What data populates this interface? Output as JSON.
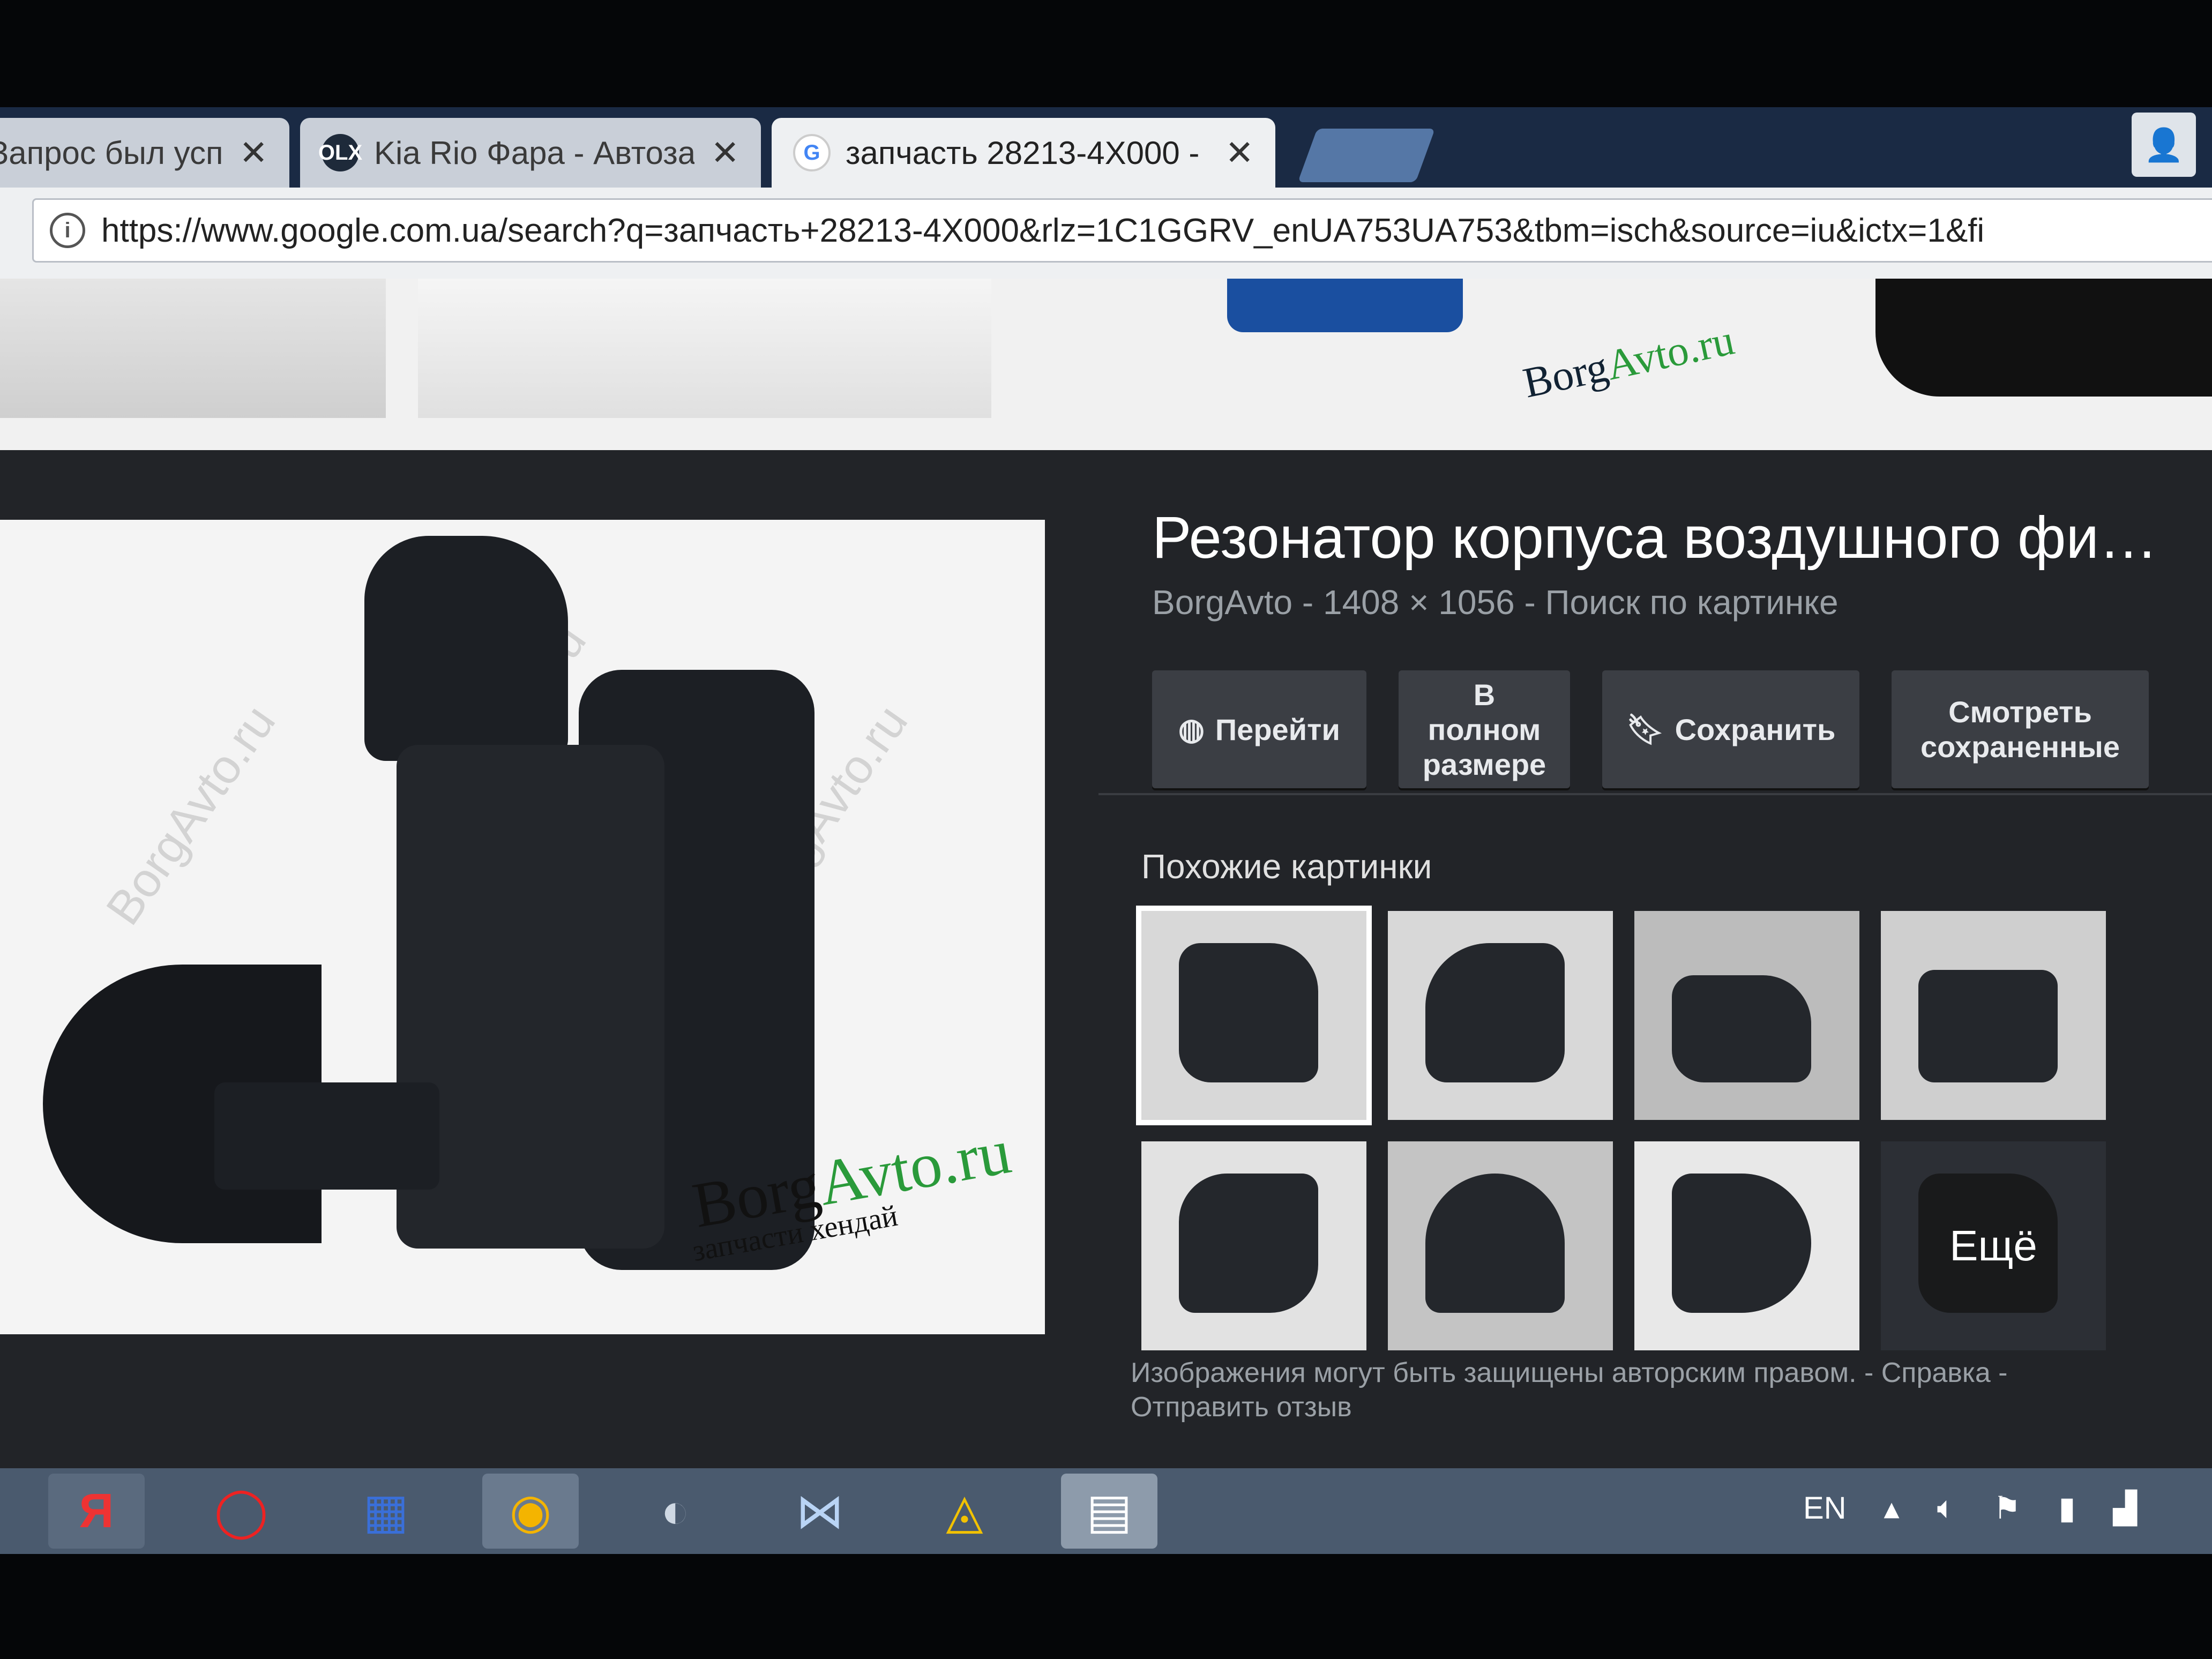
{
  "tabs": [
    {
      "label": "Запрос был успеш",
      "icon": ""
    },
    {
      "label": "Kia Rio Фара - Автозапч",
      "icon": "OLX"
    },
    {
      "label": "запчасть 28213-4X000 -",
      "icon": "G"
    }
  ],
  "tab_close": "✕",
  "address": {
    "url": "https://www.google.com.ua/search?q=запчасть+28213-4X000&rlz=1C1GGRV_enUA753UA753&tbm=isch&source=iu&ictx=1&fi"
  },
  "preview": {
    "title": "Резонатор корпуса воздушного фи…",
    "meta": "BorgAvto - 1408 × 1056 - Поиск по картинке",
    "logo_main": "Borg",
    "logo_accent": "Avto.ru",
    "logo_sub": "запчасти хендай",
    "watermark": "BorgAvto.ru"
  },
  "actions": [
    {
      "label": "Перейти",
      "icon": "globe-icon"
    },
    {
      "label": "В полном размере",
      "icon": ""
    },
    {
      "label": "Сохранить",
      "icon": "bookmark-icon"
    },
    {
      "label": "Смотреть сохраненные",
      "icon": ""
    }
  ],
  "similar": {
    "title": "Похожие картинки",
    "more_label": "Ещё"
  },
  "footer": {
    "text": "Изображения могут быть защищены авторским правом. - Справка -",
    "feedback": "Отправить отзыв"
  },
  "tray": {
    "lang": "EN"
  },
  "colors": {
    "panel_bg": "#222428",
    "button_bg": "#3b3e44",
    "logo_green": "#2a9a3a"
  }
}
